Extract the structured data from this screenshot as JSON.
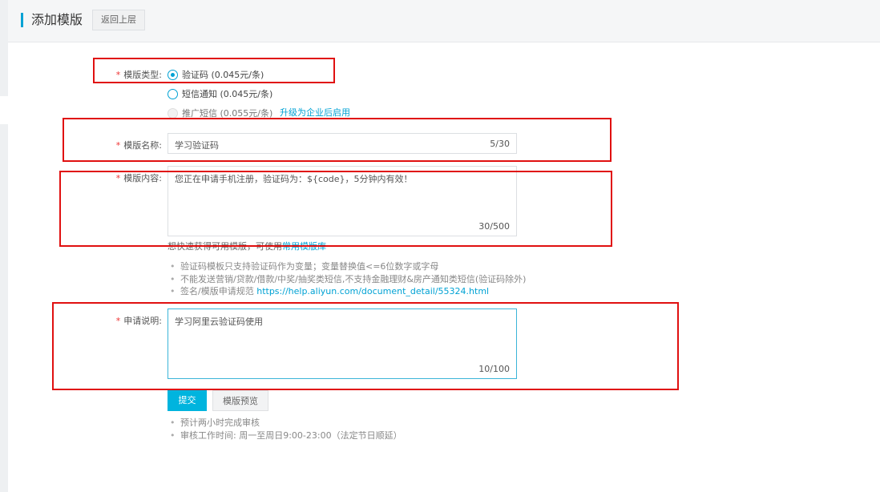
{
  "header": {
    "title": "添加模版",
    "back_label": "返回上层"
  },
  "form": {
    "type": {
      "label": "模版类型:",
      "options": [
        {
          "label": "验证码 (0.045元/条)",
          "checked": true,
          "disabled": false
        },
        {
          "label": "短信通知 (0.045元/条)",
          "checked": false,
          "disabled": false
        },
        {
          "label": "推广短信 (0.055元/条)",
          "checked": false,
          "disabled": true
        }
      ],
      "upgrade_link": "升级为企业后启用"
    },
    "name": {
      "label": "模版名称:",
      "value": "学习验证码",
      "count": "5/30"
    },
    "content": {
      "label": "模版内容:",
      "value": "您正在申请手机注册，验证码为：${code}，5分钟内有效！",
      "count": "30/500",
      "hint_prefix": "想快速获得可用模版，可使用",
      "hint_link": "常用模版库",
      "rules": [
        "验证码模板只支持验证码作为变量；变量替换值<=6位数字或字母",
        "不能发送营销/贷款/借款/中奖/抽奖类短信,不支持金融理财&房产通知类短信(验证码除外)"
      ],
      "rule3_prefix": "签名/模版申请规范",
      "rule3_link": "https://help.aliyun.com/document_detail/55324.html"
    },
    "desc": {
      "label": "申请说明:",
      "value": "学习阿里云验证码使用",
      "count": "10/100"
    },
    "buttons": {
      "submit": "提交",
      "preview": "模版预览"
    },
    "notes": [
      "预计两小时完成审核",
      "审核工作时间: 周一至周日9:00-23:00（法定节日顺延）"
    ]
  },
  "colors": {
    "accent": "#00a2d4",
    "required": "#e33333",
    "annotation": "#e01010"
  }
}
